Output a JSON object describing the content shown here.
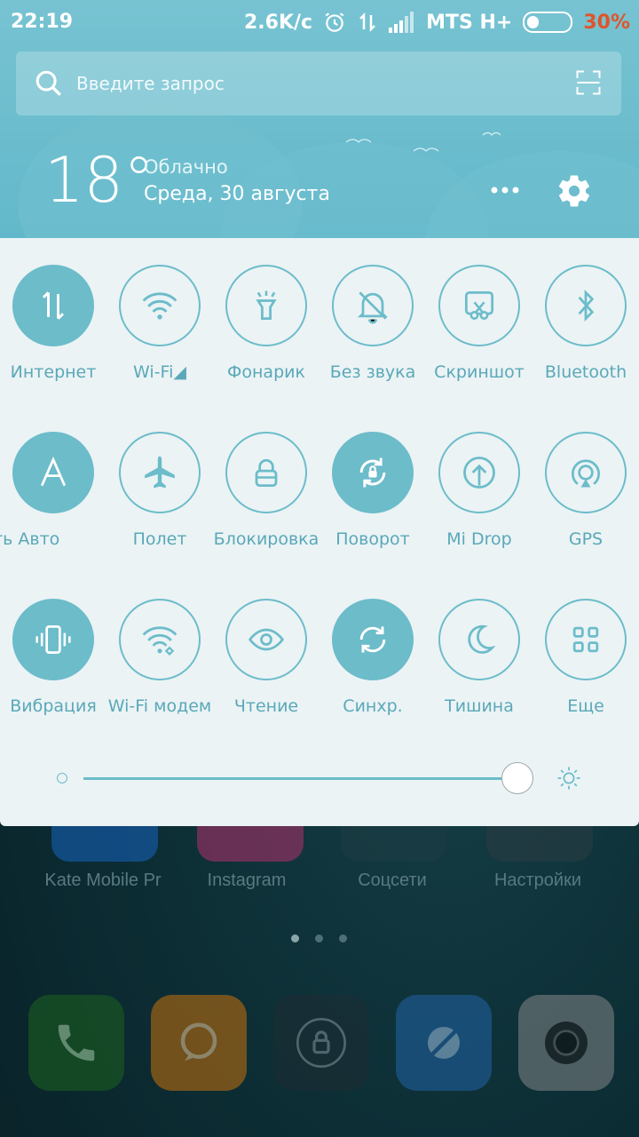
{
  "status": {
    "time": "22:19",
    "speed": "2.6K/c",
    "carrier": "MTS H+",
    "battery_pct": "30%",
    "battery_level": 0.3
  },
  "search": {
    "placeholder": "Введите запрос"
  },
  "weather": {
    "temperature": "18°",
    "condition": "Облачно",
    "date": "Среда, 30 августа"
  },
  "toggles": {
    "row1": [
      {
        "label": "Интернет",
        "icon": "mobile-data-icon",
        "on": true
      },
      {
        "label": "Wi-Fi◢",
        "icon": "wifi-icon",
        "on": false
      },
      {
        "label": "Фонарик",
        "icon": "flashlight-icon",
        "on": false
      },
      {
        "label": "Без звука",
        "icon": "mute-bell-icon",
        "on": false
      },
      {
        "label": "Скриншот",
        "icon": "screenshot-icon",
        "on": false
      },
      {
        "label": "Bluetooth",
        "icon": "bluetooth-icon",
        "on": false
      }
    ],
    "row2": [
      {
        "label": "ость   Авто",
        "icon": "auto-brightness-icon",
        "on": true
      },
      {
        "label": "Полет",
        "icon": "airplane-icon",
        "on": false
      },
      {
        "label": "Блокировка",
        "icon": "lock-icon",
        "on": false
      },
      {
        "label": "Поворот",
        "icon": "rotation-lock-icon",
        "on": true
      },
      {
        "label": "Mi Drop",
        "icon": "mi-drop-icon",
        "on": false
      },
      {
        "label": "GPS",
        "icon": "gps-icon",
        "on": false
      }
    ],
    "row3": [
      {
        "label": "Вибрация",
        "icon": "vibration-icon",
        "on": true
      },
      {
        "label": "Wi-Fi модем",
        "icon": "hotspot-icon",
        "on": false
      },
      {
        "label": "Чтение",
        "icon": "reading-eye-icon",
        "on": false
      },
      {
        "label": "Синхр.",
        "icon": "sync-icon",
        "on": true
      },
      {
        "label": "Тишина",
        "icon": "moon-icon",
        "on": false
      },
      {
        "label": "Еще",
        "icon": "more-grid-icon",
        "on": false
      }
    ]
  },
  "brightness": {
    "level": 0.97
  },
  "home": {
    "apps": [
      "Kate Mobile Pr",
      "Instagram",
      "Соцсети",
      "Настройки"
    ],
    "page_count": 3,
    "current_page": 1,
    "dock": [
      "phone-icon",
      "messages-icon",
      "lock-icon",
      "browser-icon",
      "camera-icon"
    ]
  },
  "colors": {
    "accent": "#6cbcca",
    "header": "#6bbccd",
    "battery_low": "#e0542a"
  }
}
